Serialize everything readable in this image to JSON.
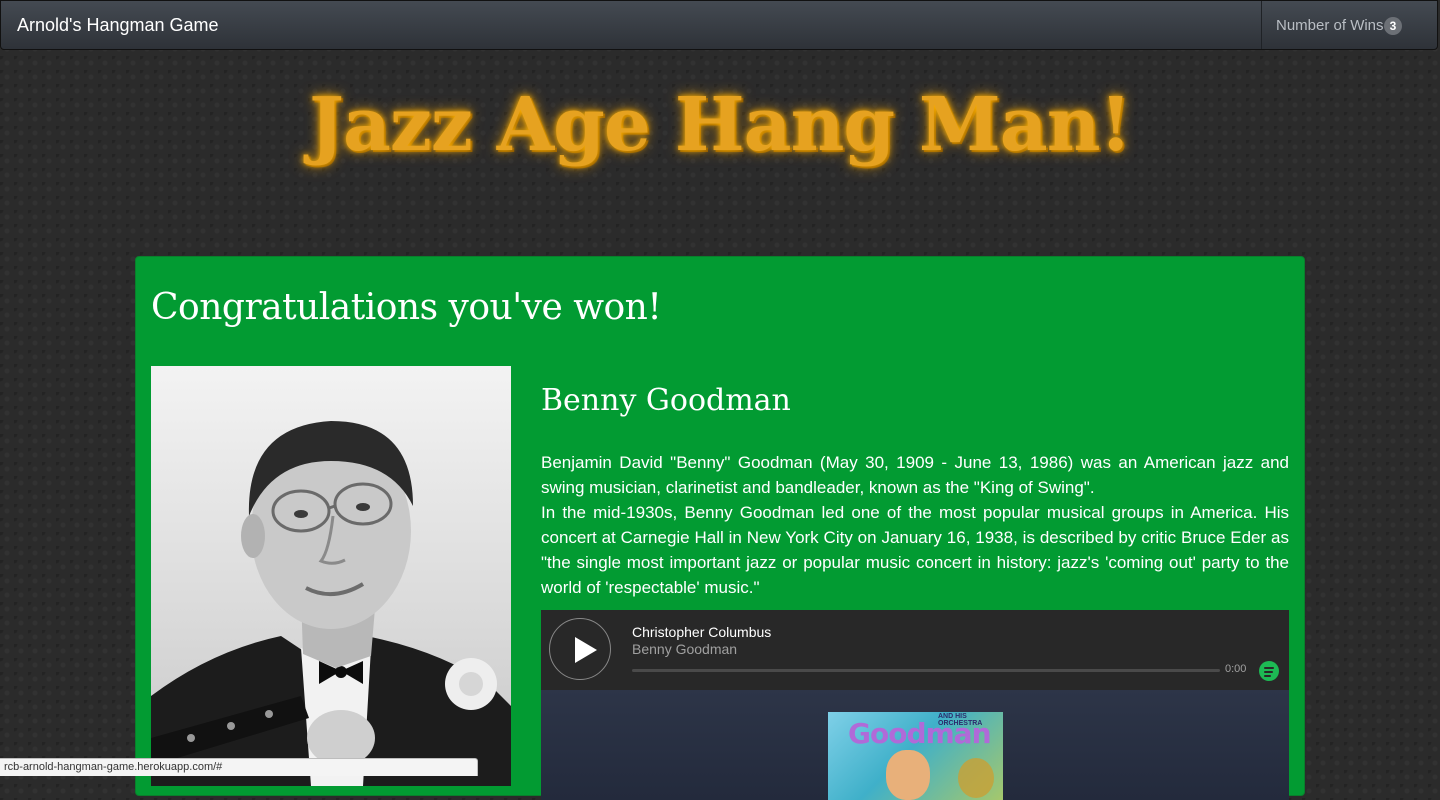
{
  "navbar": {
    "brand": "Arnold's Hangman Game",
    "wins_label": "Number of Wins",
    "wins_count": "3"
  },
  "hero": {
    "title": "Jazz Age Hang Man!"
  },
  "result": {
    "heading": "Congratulations you've won!",
    "artist_name": "Benny Goodman",
    "bio_1": "Benjamin David \"Benny\" Goodman (May 30, 1909 - June 13, 1986) was an American jazz and swing musician, clarinetist and bandleader, known as the \"King of Swing\".",
    "bio_2": "In the mid-1930s, Benny Goodman led one of the most popular musical groups in America. His concert at Carnegie Hall in New York City on January 16, 1938, is described by critic Bruce Eder as \"the single most important jazz or popular music concert in history: jazz's 'coming out' party to the world of 'respectable' music.\""
  },
  "player": {
    "track_title": "Christopher Columbus",
    "track_artist": "Benny Goodman",
    "time": "0:00",
    "progress": 0,
    "cover_title": "Goodman",
    "cover_subtitle": "AND HIS ORCHESTRA"
  },
  "statusbar": {
    "url": "rcb-arnold-hangman-game.herokuapp.com/#"
  },
  "colors": {
    "panel": "#029b32",
    "hero_gold": "#e6a220",
    "spotify_green": "#1db954",
    "navbar": "#3a3f45"
  }
}
